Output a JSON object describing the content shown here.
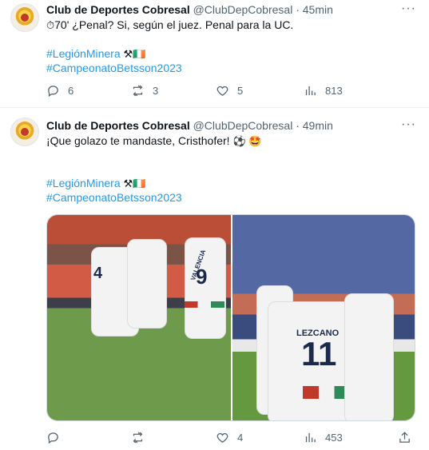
{
  "tweets": [
    {
      "name": "Club de Deportes Cobresal",
      "handle": "@ClubDepCobresal",
      "sep": "·",
      "time": "45min",
      "text_emoji": "⏱",
      "text": "70' ¿Penal? Si, según el juez. Penal para la UC.",
      "hashtag1": "#LegiónMinera",
      "hashtag1_emoji": "⚒🇮🇪",
      "hashtag2": "#CampeonatoBetsson2023",
      "replies": "6",
      "retweets": "3",
      "likes": "5",
      "views": "813"
    },
    {
      "name": "Club de Deportes Cobresal",
      "handle": "@ClubDepCobresal",
      "sep": "·",
      "time": "49min",
      "text": "¡Que golazo te mandaste, Cristhofer!",
      "text_emoji": "⚽ 🤩",
      "hashtag1": "#LegiónMinera",
      "hashtag1_emoji": "⚒🇮🇪",
      "hashtag2": "#CampeonatoBetsson2023",
      "replies": "",
      "retweets": "",
      "likes": "4",
      "views": "453",
      "photo_right_name": "LEZCANO",
      "photo_right_number": "11",
      "photo_left_number": "9",
      "photo_left_name": "VALENCIA",
      "photo_left_number2": "4"
    }
  ],
  "colors": {
    "link": "#1d9bf0",
    "muted": "#536471"
  }
}
